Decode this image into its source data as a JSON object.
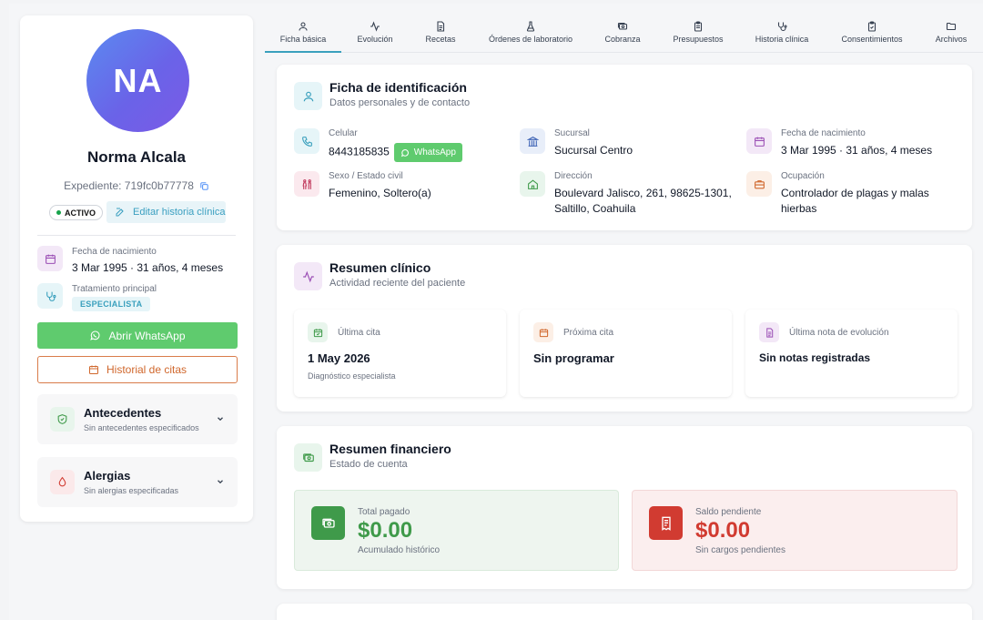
{
  "profile": {
    "initials": "NA",
    "name": "Norma Alcala",
    "expediente": "Expediente: 719fc0b77778",
    "status": "ACTIVO",
    "edit_label": "Editar historia clínica",
    "birth_label": "Fecha de nacimiento",
    "birth_value": "3 Mar 1995 · 31 años, 4 meses",
    "treatment_label": "Tratamiento principal",
    "treatment_value": "ESPECIALISTA",
    "whatsapp_label": "Abrir WhatsApp",
    "history_label": "Historial de citas",
    "antecedentes_title": "Antecedentes",
    "antecedentes_sub": "Sin antecedentes especificados",
    "alergias_title": "Alergias",
    "alergias_sub": "Sin alergias especificadas"
  },
  "tabs": [
    {
      "label": "Ficha básica",
      "icon": "user-icon"
    },
    {
      "label": "Evolución",
      "icon": "activity-icon"
    },
    {
      "label": "Recetas",
      "icon": "document-icon"
    },
    {
      "label": "Órdenes de laboratorio",
      "icon": "flask-icon"
    },
    {
      "label": "Cobranza",
      "icon": "money-icon"
    },
    {
      "label": "Presupuestos",
      "icon": "clipboard-icon"
    },
    {
      "label": "Historia clínica",
      "icon": "stethoscope-icon"
    },
    {
      "label": "Consentimientos",
      "icon": "clipboard-check-icon"
    },
    {
      "label": "Archivos",
      "icon": "folder-icon"
    }
  ],
  "ident": {
    "title": "Ficha de identificación",
    "subtitle": "Datos personales y de contacto",
    "celular_label": "Celular",
    "celular_value": "8443185835",
    "whatsapp_chip": "WhatsApp",
    "sucursal_label": "Sucursal",
    "sucursal_value": "Sucursal Centro",
    "nacimiento_label": "Fecha de nacimiento",
    "nacimiento_value": "3 Mar 1995 · 31 años, 4 meses",
    "sexo_label": "Sexo / Estado civil",
    "sexo_value": "Femenino, Soltero(a)",
    "direccion_label": "Dirección",
    "direccion_value": "Boulevard Jalisco, 261, 98625-1301, Saltillo, Coahuila",
    "ocupacion_label": "Ocupación",
    "ocupacion_value": "Controlador de plagas y malas hierbas"
  },
  "clinical": {
    "title": "Resumen clínico",
    "subtitle": "Actividad reciente del paciente",
    "last_label": "Última cita",
    "last_value": "1 May 2026",
    "last_note": "Diagnóstico especialista",
    "next_label": "Próxima cita",
    "next_value": "Sin programar",
    "note_label": "Última nota de evolución",
    "note_value": "Sin notas registradas"
  },
  "finance": {
    "title": "Resumen financiero",
    "subtitle": "Estado de cuenta",
    "paid_label": "Total pagado",
    "paid_value": "$0.00",
    "paid_note": "Acumulado histórico",
    "due_label": "Saldo pendiente",
    "due_value": "$0.00",
    "due_note": "Sin cargos pendientes"
  },
  "colors": {
    "accent": "#3aa0bd",
    "whatsapp": "#5fcb6e",
    "paid": "#3f9a4a",
    "due": "#d13b31"
  }
}
